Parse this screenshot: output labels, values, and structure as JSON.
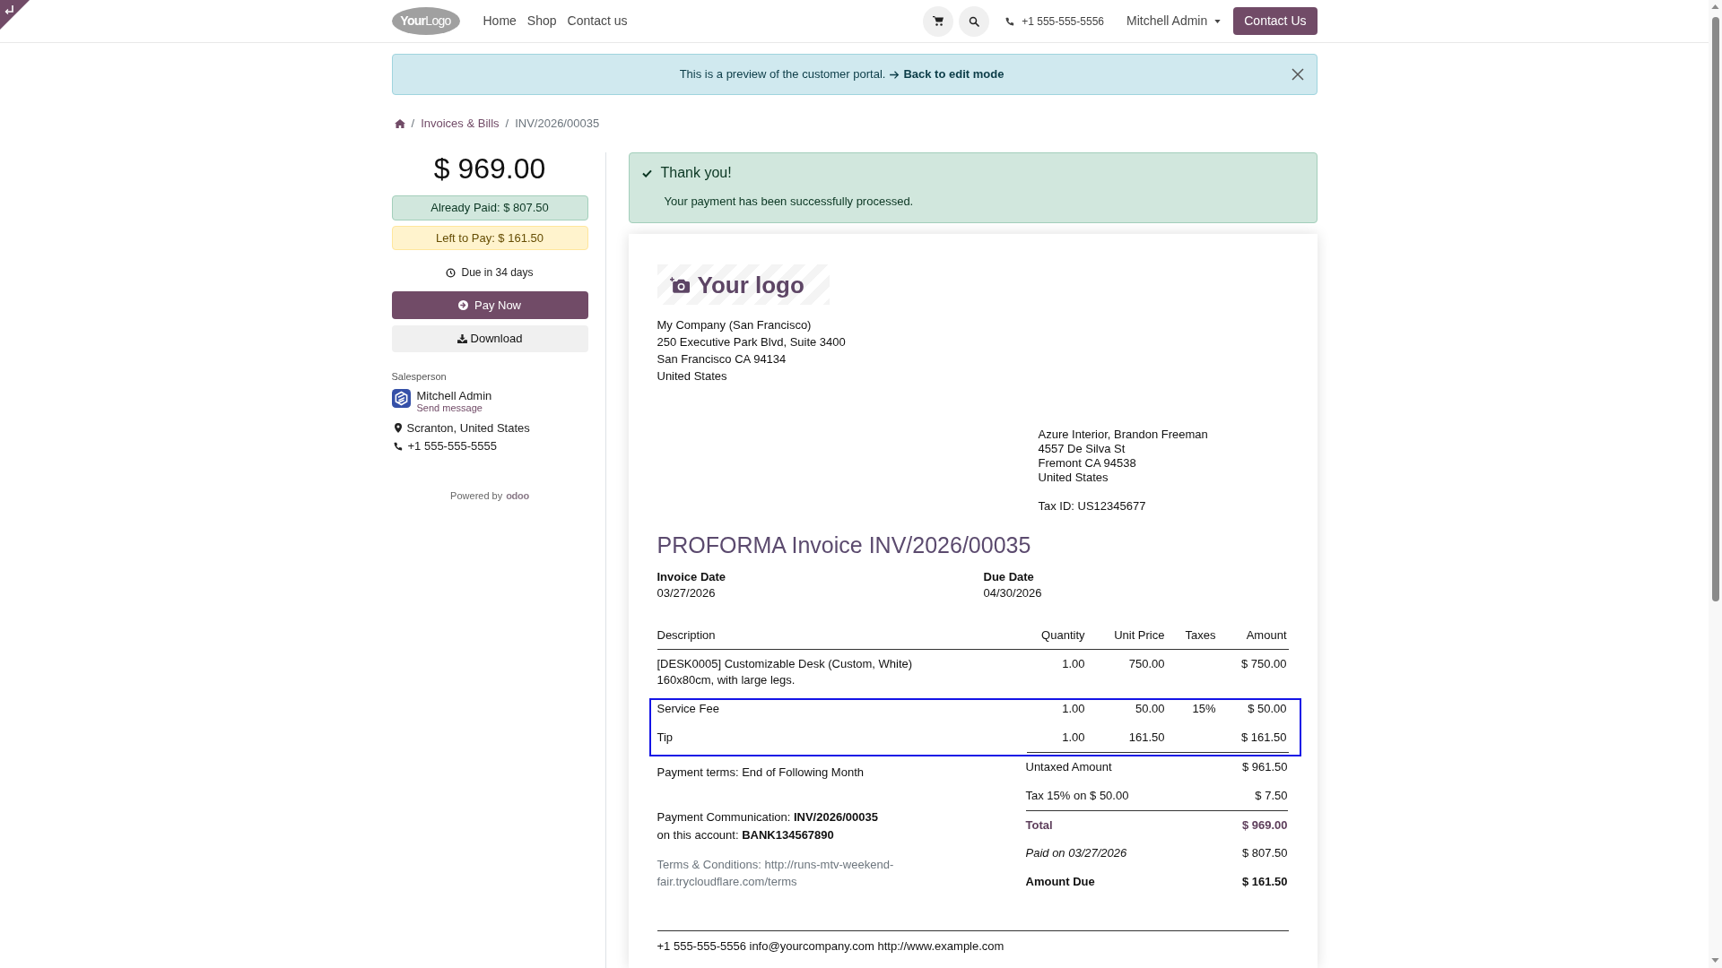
{
  "navbar": {
    "logo": "**Your**Logo",
    "links": [
      "Home",
      "Shop",
      "Contact us"
    ],
    "phone": "+1 555-555-5556",
    "user": "Mitchell Admin",
    "contact_button": "Contact Us"
  },
  "preview_banner": {
    "text": "This is a preview of the customer portal.",
    "link": "Back to edit mode"
  },
  "breadcrumb": {
    "separator": "/",
    "items": [
      "Invoices & Bills",
      "INV/2026/00035"
    ]
  },
  "sidebar": {
    "total": "$ 969.00",
    "already_paid": "Already Paid: $ 807.50",
    "left_to_pay": "Left to Pay: $ 161.50",
    "due": "Due in 34 days",
    "pay_button": "Pay Now",
    "download_button": "Download",
    "salesperson": {
      "label": "Salesperson",
      "name": "Mitchell Admin",
      "action": "Send message",
      "location": "Scranton, United States",
      "phone": "+1 555-555-5555"
    },
    "powered_by": {
      "text": "Powered by",
      "brand": "odoo"
    }
  },
  "payment_alert": {
    "title": "Thank you!",
    "message": "Your payment has been successfully processed."
  },
  "invoice": {
    "logo": "Your logo",
    "company_address": [
      "My Company (San Francisco)",
      "250 Executive Park Blvd, Suite 3400",
      "San Francisco CA 94134",
      "United States"
    ],
    "customer_address": [
      "Azure Interior, Brandon Freeman",
      "4557 De Silva St",
      "Fremont CA 94538",
      "United States"
    ],
    "tax_id": "Tax ID: US12345677",
    "title": "PROFORMA Invoice INV/2026/00035",
    "dates": [
      {
        "label": "Invoice Date",
        "value": "03/27/2026"
      },
      {
        "label": "Due Date",
        "value": "04/30/2026"
      }
    ],
    "table": {
      "columns": [
        "Description",
        "Quantity",
        "Unit Price",
        "Taxes",
        "Amount"
      ],
      "rows": [
        {
          "description": "[DESK0005] Customizable Desk (Custom, White)\n160x80cm, with large legs.",
          "quantity": "1.00",
          "unit_price": "750.00",
          "amount": "$ 750.00",
          "highlighted": false
        },
        {
          "description": "Service Fee",
          "quantity": "1.00",
          "unit_price": "50.00",
          "taxes": "15%",
          "amount": "$ 50.00",
          "highlighted": true
        },
        {
          "description": "Tip",
          "quantity": "1.00",
          "unit_price": "161.50",
          "amount": "$ 161.50",
          "highlighted": true
        }
      ]
    },
    "payment_terms": "Payment terms: End of Following Month",
    "payment_communication": [
      "Payment Communication: **INV/2026/00035**",
      "on this account: **BANK134567890**"
    ],
    "terms": "Terms & Conditions: http://runs-mtv-weekend-fair.trycloudflare.com/terms",
    "totals": [
      {
        "kind": "subtotal",
        "label": "Untaxed Amount",
        "value": "$ 961.50"
      },
      {
        "kind": "subtotal",
        "label": "Tax 15% on $ 50.00",
        "value": "$ 7.50"
      },
      {
        "kind": "total",
        "label": "Total",
        "value": "$ 969.00"
      },
      {
        "kind": "paid",
        "label": "Paid on 03/27/2026",
        "value": "$ 807.50"
      },
      {
        "kind": "due",
        "label": "Amount Due",
        "value": "$ 161.50"
      }
    ],
    "footer": "+1 555-555-5556 info@yourcompany.com http://www.example.com"
  }
}
